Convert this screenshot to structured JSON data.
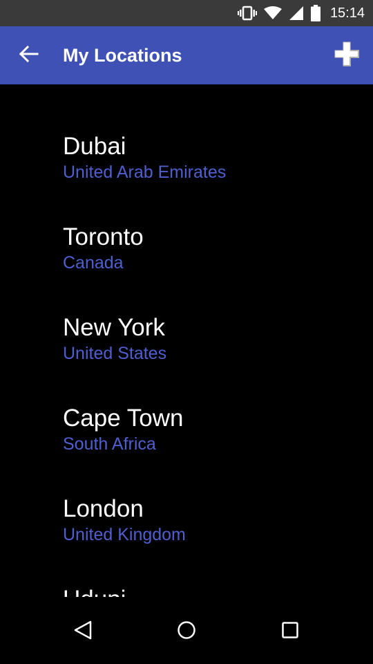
{
  "status_bar": {
    "time": "15:14",
    "icons": [
      "vibrate-icon",
      "wifi-icon",
      "cell-signal-icon",
      "battery-icon"
    ]
  },
  "app_bar": {
    "title": "My Locations",
    "back_icon": "arrow-back-icon",
    "add_icon": "plus-icon",
    "color": "#3f51b5"
  },
  "locations": [
    {
      "city": "Dubai",
      "country": "United Arab Emirates"
    },
    {
      "city": "Toronto",
      "country": "Canada"
    },
    {
      "city": "New York",
      "country": "United States"
    },
    {
      "city": "Cape Town",
      "country": "South Africa"
    },
    {
      "city": "London",
      "country": "United Kingdom"
    },
    {
      "city": "Udupi",
      "country": ""
    }
  ],
  "colors": {
    "background": "#000000",
    "city_text": "#ffffff",
    "country_text": "#4f5fcf",
    "status_bar": "#3a3a3a"
  },
  "nav_bar": {
    "icons": [
      "nav-back-icon",
      "nav-home-icon",
      "nav-recents-icon"
    ]
  }
}
